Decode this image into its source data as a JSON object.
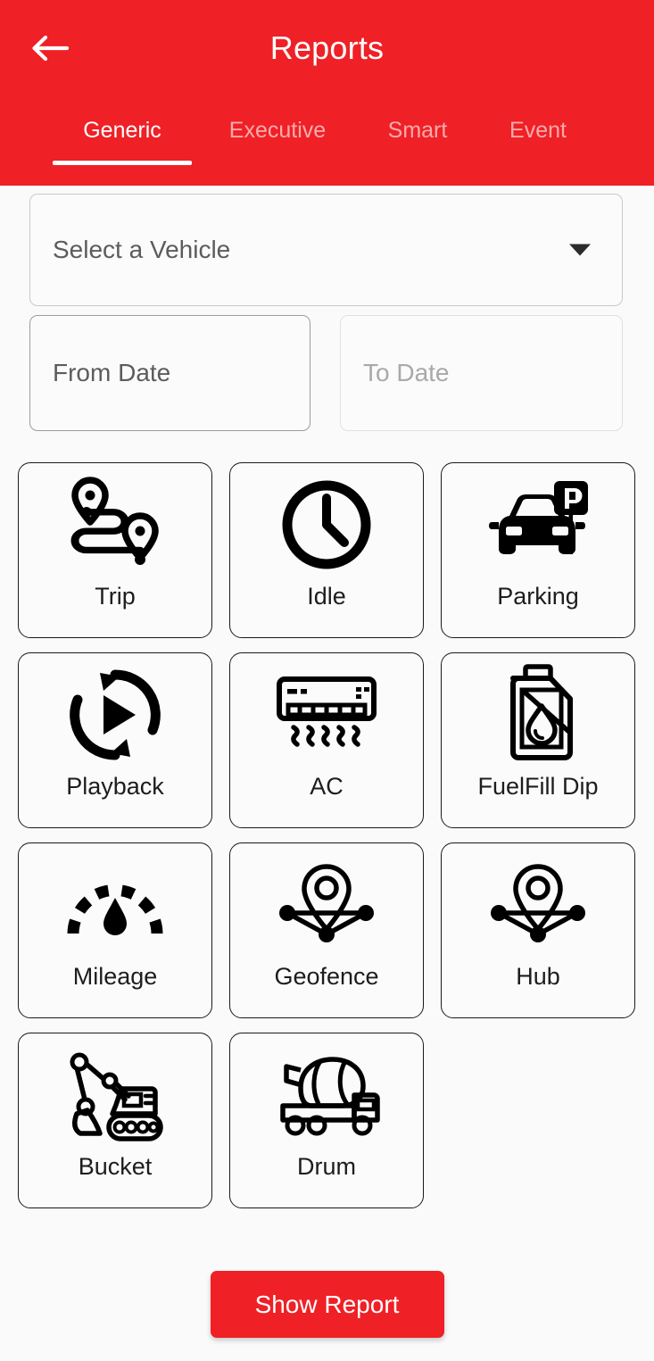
{
  "header": {
    "title": "Reports",
    "back_icon": "arrow-left-icon",
    "background_color": "#EF2026",
    "tabs": [
      {
        "label": "Generic",
        "active": true
      },
      {
        "label": "Executive",
        "active": false
      },
      {
        "label": "Smart",
        "active": false
      },
      {
        "label": "Event",
        "active": false
      }
    ]
  },
  "form": {
    "vehicle_select": {
      "value": "Select a Vehicle",
      "placeholder": "Select a Vehicle",
      "caret_icon": "chevron-down-icon"
    },
    "from_date": {
      "value": "",
      "placeholder": "From Date"
    },
    "to_date": {
      "value": "",
      "placeholder": "To Date"
    }
  },
  "reports": [
    {
      "label": "Trip",
      "icon": "route-pins-icon"
    },
    {
      "label": "Idle",
      "icon": "clock-icon"
    },
    {
      "label": "Parking",
      "icon": "car-parking-sign-icon"
    },
    {
      "label": "Playback",
      "icon": "replay-play-icon"
    },
    {
      "label": "AC",
      "icon": "air-conditioner-icon"
    },
    {
      "label": "FuelFill Dip",
      "icon": "fuel-can-droplet-icon"
    },
    {
      "label": "Mileage",
      "icon": "gauge-droplet-icon"
    },
    {
      "label": "Geofence",
      "icon": "map-pin-network-icon"
    },
    {
      "label": "Hub",
      "icon": "map-pin-network-icon"
    },
    {
      "label": "Bucket",
      "icon": "excavator-icon"
    },
    {
      "label": "Drum",
      "icon": "concrete-mixer-truck-icon"
    }
  ],
  "footer": {
    "show_report_label": "Show Report",
    "button_color": "#EF2026"
  }
}
